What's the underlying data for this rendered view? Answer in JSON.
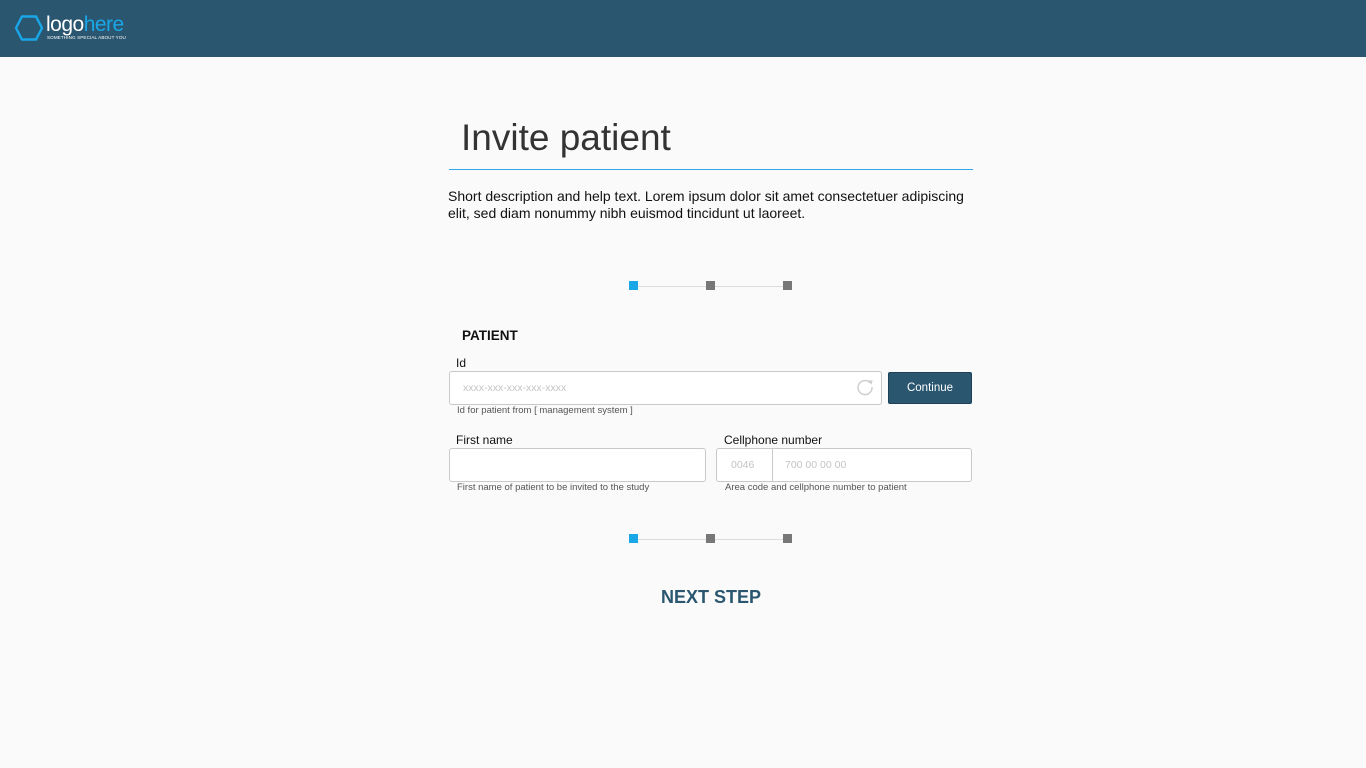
{
  "header": {
    "logo_word1": "logo",
    "logo_word2": "here",
    "logo_tagline": "SOMETHING SPECIAL ABOUT YOU",
    "bg_color": "#2a5670",
    "accent_color": "#1aa7e8"
  },
  "page": {
    "title": "Invite patient",
    "description": "Short description and help text. Lorem ipsum dolor sit amet consectetuer adipiscing elit, sed diam nonummy nibh euismod tincidunt ut laoreet."
  },
  "stepper": {
    "total_steps": 3,
    "current_step": 1
  },
  "form": {
    "section_label": "PATIENT",
    "id": {
      "label": "Id",
      "placeholder": "xxxx-xxx-xxx-xxx-xxxx",
      "value": "",
      "hint": "Id for patient from [ management system ]",
      "refresh_icon": "refresh-icon"
    },
    "continue_label": "Continue",
    "first_name": {
      "label": "First name",
      "placeholder": "",
      "value": "",
      "hint": "First name of patient to be invited to the study"
    },
    "cellphone": {
      "label": "Cellphone number",
      "area_placeholder": "0046",
      "number_placeholder": "700 00 00 00",
      "hint": "Area code and cellphone number to patient"
    }
  },
  "next_step_label": "NEXT STEP"
}
